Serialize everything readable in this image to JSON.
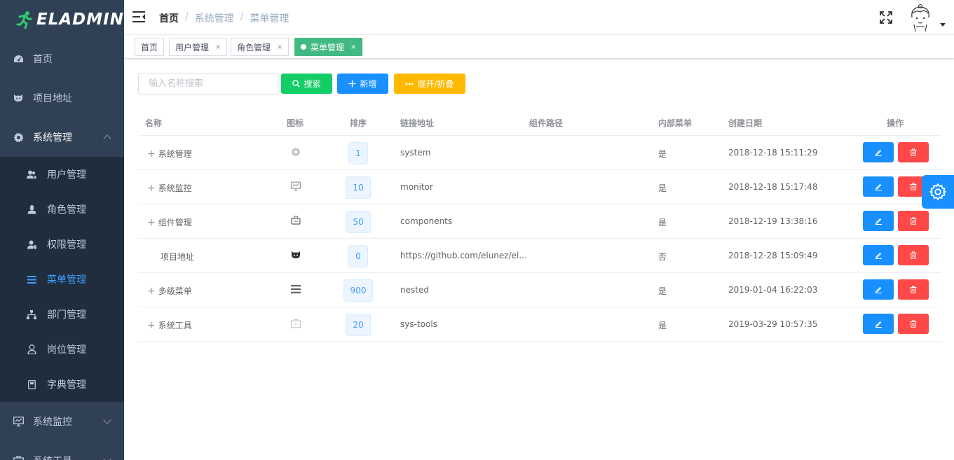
{
  "app": {
    "logo_text": "ELADMIN"
  },
  "sidebar": {
    "items": [
      {
        "label": "首页",
        "icon": "dashboard-icon"
      },
      {
        "label": "项目地址",
        "icon": "github-icon"
      },
      {
        "label": "系统管理",
        "icon": "system-gear-icon",
        "expanded": true
      }
    ],
    "submenu": [
      {
        "label": "用户管理",
        "icon": "peoples-icon"
      },
      {
        "label": "角色管理",
        "icon": "role-icon"
      },
      {
        "label": "权限管理",
        "icon": "permission-icon"
      },
      {
        "label": "菜单管理",
        "icon": "menu-icon",
        "active": true
      },
      {
        "label": "部门管理",
        "icon": "dept-icon"
      },
      {
        "label": "岗位管理",
        "icon": "job-icon"
      },
      {
        "label": "字典管理",
        "icon": "dictionary-icon"
      }
    ],
    "after": [
      {
        "label": "系统监控",
        "icon": "monitor-icon"
      },
      {
        "label": "系统工具",
        "icon": "tools-icon"
      }
    ]
  },
  "header": {
    "breadcrumb": [
      "首页",
      "系统管理",
      "菜单管理"
    ],
    "sep": "/"
  },
  "tags": [
    {
      "label": "首页",
      "closable": false
    },
    {
      "label": "用户管理",
      "closable": true
    },
    {
      "label": "角色管理",
      "closable": true
    },
    {
      "label": "菜单管理",
      "closable": true,
      "active": true
    }
  ],
  "tag_close": "×",
  "toolbar": {
    "search_placeholder": "输入名称搜索",
    "search_label": "搜索",
    "add_label": "新增",
    "expand_label": "展开/折叠"
  },
  "table": {
    "columns": [
      "名称",
      "图标",
      "排序",
      "链接地址",
      "组件路径",
      "内部菜单",
      "创建日期",
      "操作"
    ],
    "rows": [
      {
        "name": "系统管理",
        "expandable": true,
        "icon": "system-gear-icon",
        "sort": "1",
        "path": "system",
        "component": "",
        "iframe": "是",
        "date": "2018-12-18 15:11:29"
      },
      {
        "name": "系统监控",
        "expandable": true,
        "icon": "monitor-icon",
        "sort": "10",
        "path": "monitor",
        "component": "",
        "iframe": "是",
        "date": "2018-12-18 15:17:48"
      },
      {
        "name": "组件管理",
        "expandable": true,
        "icon": "zujian-icon",
        "sort": "50",
        "path": "components",
        "component": "",
        "iframe": "是",
        "date": "2018-12-19 13:38:16"
      },
      {
        "name": "项目地址",
        "expandable": false,
        "icon": "github-icon",
        "sort": "0",
        "path": "https://github.com/elunez/el...",
        "component": "",
        "iframe": "否",
        "date": "2018-12-28 15:09:49"
      },
      {
        "name": "多级菜单",
        "expandable": true,
        "icon": "menu-icon",
        "sort": "900",
        "path": "nested",
        "component": "",
        "iframe": "是",
        "date": "2019-01-04 16:22:03"
      },
      {
        "name": "系统工具",
        "expandable": true,
        "icon": "tools-icon",
        "sort": "20",
        "path": "sys-tools",
        "component": "",
        "iframe": "是",
        "date": "2019-03-29 10:57:35"
      }
    ]
  },
  "colors": {
    "sidebar_bg": "#304156",
    "submenu_bg": "#1f2d3d",
    "primary": "#1890ff",
    "success": "#13ce66",
    "warning": "#ffba00",
    "danger": "#ff4949",
    "tag_active": "#42b983"
  }
}
